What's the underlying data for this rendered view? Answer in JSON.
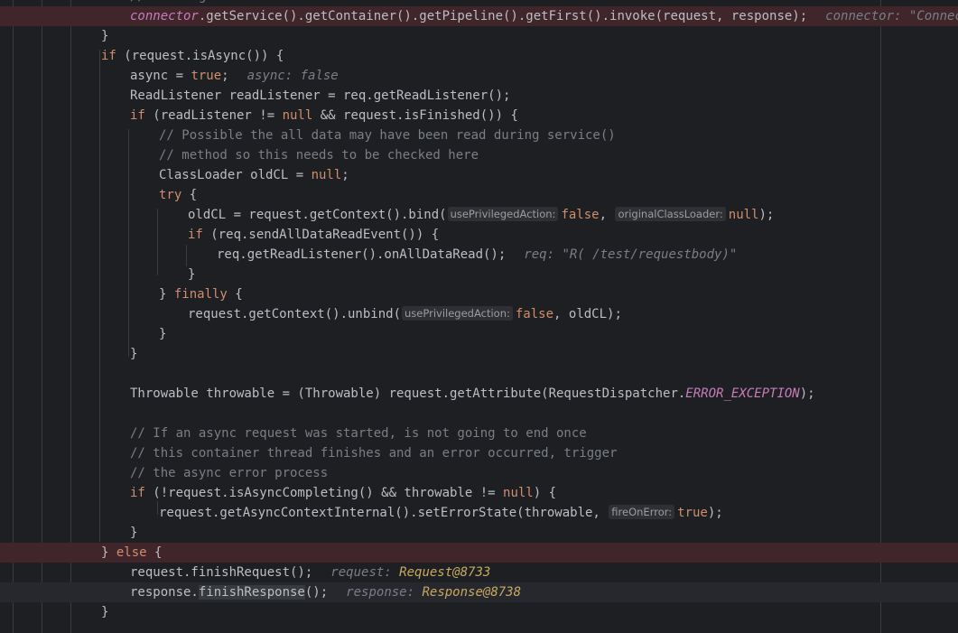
{
  "lines": [
    {
      "segs": [
        {
          "c": "cmt",
          "t": "// calling the container"
        }
      ]
    },
    {
      "segs": [
        {
          "c": "field",
          "t": "connector"
        },
        {
          "t": ".getService().getContainer().getPipeline().getFirst().invoke(request, response);"
        },
        {
          "c": "dbg",
          "t": "connector: \"Connector[\""
        }
      ]
    },
    {
      "segs": [
        {
          "t": "}"
        }
      ]
    },
    {
      "segs": [
        {
          "c": "kw",
          "t": "if"
        },
        {
          "t": " (request.isAsync()) {"
        }
      ]
    },
    {
      "segs": [
        {
          "t": "async = "
        },
        {
          "c": "kw",
          "t": "true"
        },
        {
          "t": ";"
        },
        {
          "c": "dbg",
          "t": "async: false"
        }
      ]
    },
    {
      "segs": [
        {
          "t": "ReadListener readListener = req.getReadListener();"
        }
      ]
    },
    {
      "segs": [
        {
          "c": "kw",
          "t": "if"
        },
        {
          "t": " (readListener != "
        },
        {
          "c": "kw",
          "t": "null"
        },
        {
          "t": " && request.isFinished()) {"
        }
      ]
    },
    {
      "segs": [
        {
          "c": "cmt",
          "t": "// Possible the all data may have been read during service()"
        }
      ]
    },
    {
      "segs": [
        {
          "c": "cmt",
          "t": "// method so this needs to be checked here"
        }
      ]
    },
    {
      "segs": [
        {
          "t": "ClassLoader oldCL = "
        },
        {
          "c": "kw",
          "t": "null"
        },
        {
          "t": ";"
        }
      ]
    },
    {
      "segs": [
        {
          "c": "kw",
          "t": "try"
        },
        {
          "t": " {"
        }
      ]
    },
    {
      "segs": [
        {
          "t": "oldCL = request.getContext().bind("
        },
        {
          "c": "hint",
          "t": "usePrivilegedAction:"
        },
        {
          "c": "kw",
          "t": "false"
        },
        {
          "t": ", "
        },
        {
          "c": "hint",
          "t": "originalClassLoader:"
        },
        {
          "c": "kw",
          "t": "null"
        },
        {
          "t": ");"
        }
      ]
    },
    {
      "segs": [
        {
          "c": "kw",
          "t": "if"
        },
        {
          "t": " (req.sendAllDataReadEvent()) {"
        }
      ]
    },
    {
      "segs": [
        {
          "t": "req.getReadListener().onAllDataRead();"
        },
        {
          "c": "dbg",
          "t": "req: \"R( /test/requestbody)\""
        }
      ]
    },
    {
      "segs": [
        {
          "t": "}"
        }
      ]
    },
    {
      "segs": [
        {
          "t": "} "
        },
        {
          "c": "kw",
          "t": "finally"
        },
        {
          "t": " {"
        }
      ]
    },
    {
      "segs": [
        {
          "t": "request.getContext().unbind("
        },
        {
          "c": "hint",
          "t": "usePrivilegedAction:"
        },
        {
          "c": "kw",
          "t": "false"
        },
        {
          "t": ", oldCL);"
        }
      ]
    },
    {
      "segs": [
        {
          "t": "}"
        }
      ]
    },
    {
      "segs": [
        {
          "t": "}"
        }
      ]
    },
    {
      "segs": []
    },
    {
      "segs": [
        {
          "t": "Throwable throwable = (Throwable) request.getAttribute(RequestDispatcher."
        },
        {
          "c": "field",
          "t": "ERROR_EXCEPTION"
        },
        {
          "t": ");"
        }
      ]
    },
    {
      "segs": []
    },
    {
      "segs": [
        {
          "c": "cmt",
          "t": "// If an async request was started, is not going to end once"
        }
      ]
    },
    {
      "segs": [
        {
          "c": "cmt",
          "t": "// this container thread finishes and an error occurred, trigger"
        }
      ]
    },
    {
      "segs": [
        {
          "c": "cmt",
          "t": "// the async error process"
        }
      ]
    },
    {
      "segs": [
        {
          "c": "kw",
          "t": "if"
        },
        {
          "t": " (!request.isAsyncCompleting() && throwable != "
        },
        {
          "c": "kw",
          "t": "null"
        },
        {
          "t": ") {"
        }
      ]
    },
    {
      "segs": [
        {
          "t": "request.getAsyncContextInternal().setErrorState(throwable, "
        },
        {
          "c": "hint",
          "t": "fireOnError:"
        },
        {
          "c": "kw",
          "t": "true"
        },
        {
          "t": ");"
        }
      ]
    },
    {
      "segs": [
        {
          "t": "}"
        }
      ]
    },
    {
      "segs": [
        {
          "t": "} "
        },
        {
          "c": "kw",
          "t": "else"
        },
        {
          "t": " {"
        }
      ]
    },
    {
      "segs": [
        {
          "t": "request.finishRequest();"
        },
        {
          "c": "dbg",
          "t": "request: "
        },
        {
          "c": "dbg-val",
          "t": "Request@8733"
        }
      ]
    },
    {
      "segs": [
        {
          "t": "response."
        },
        {
          "c": "hl",
          "t": "finishResponse"
        },
        {
          "t": "();"
        },
        {
          "c": "dbg",
          "t": "response: "
        },
        {
          "c": "dbg-val",
          "t": "Response@8738"
        }
      ]
    },
    {
      "segs": [
        {
          "t": "}"
        }
      ]
    }
  ]
}
